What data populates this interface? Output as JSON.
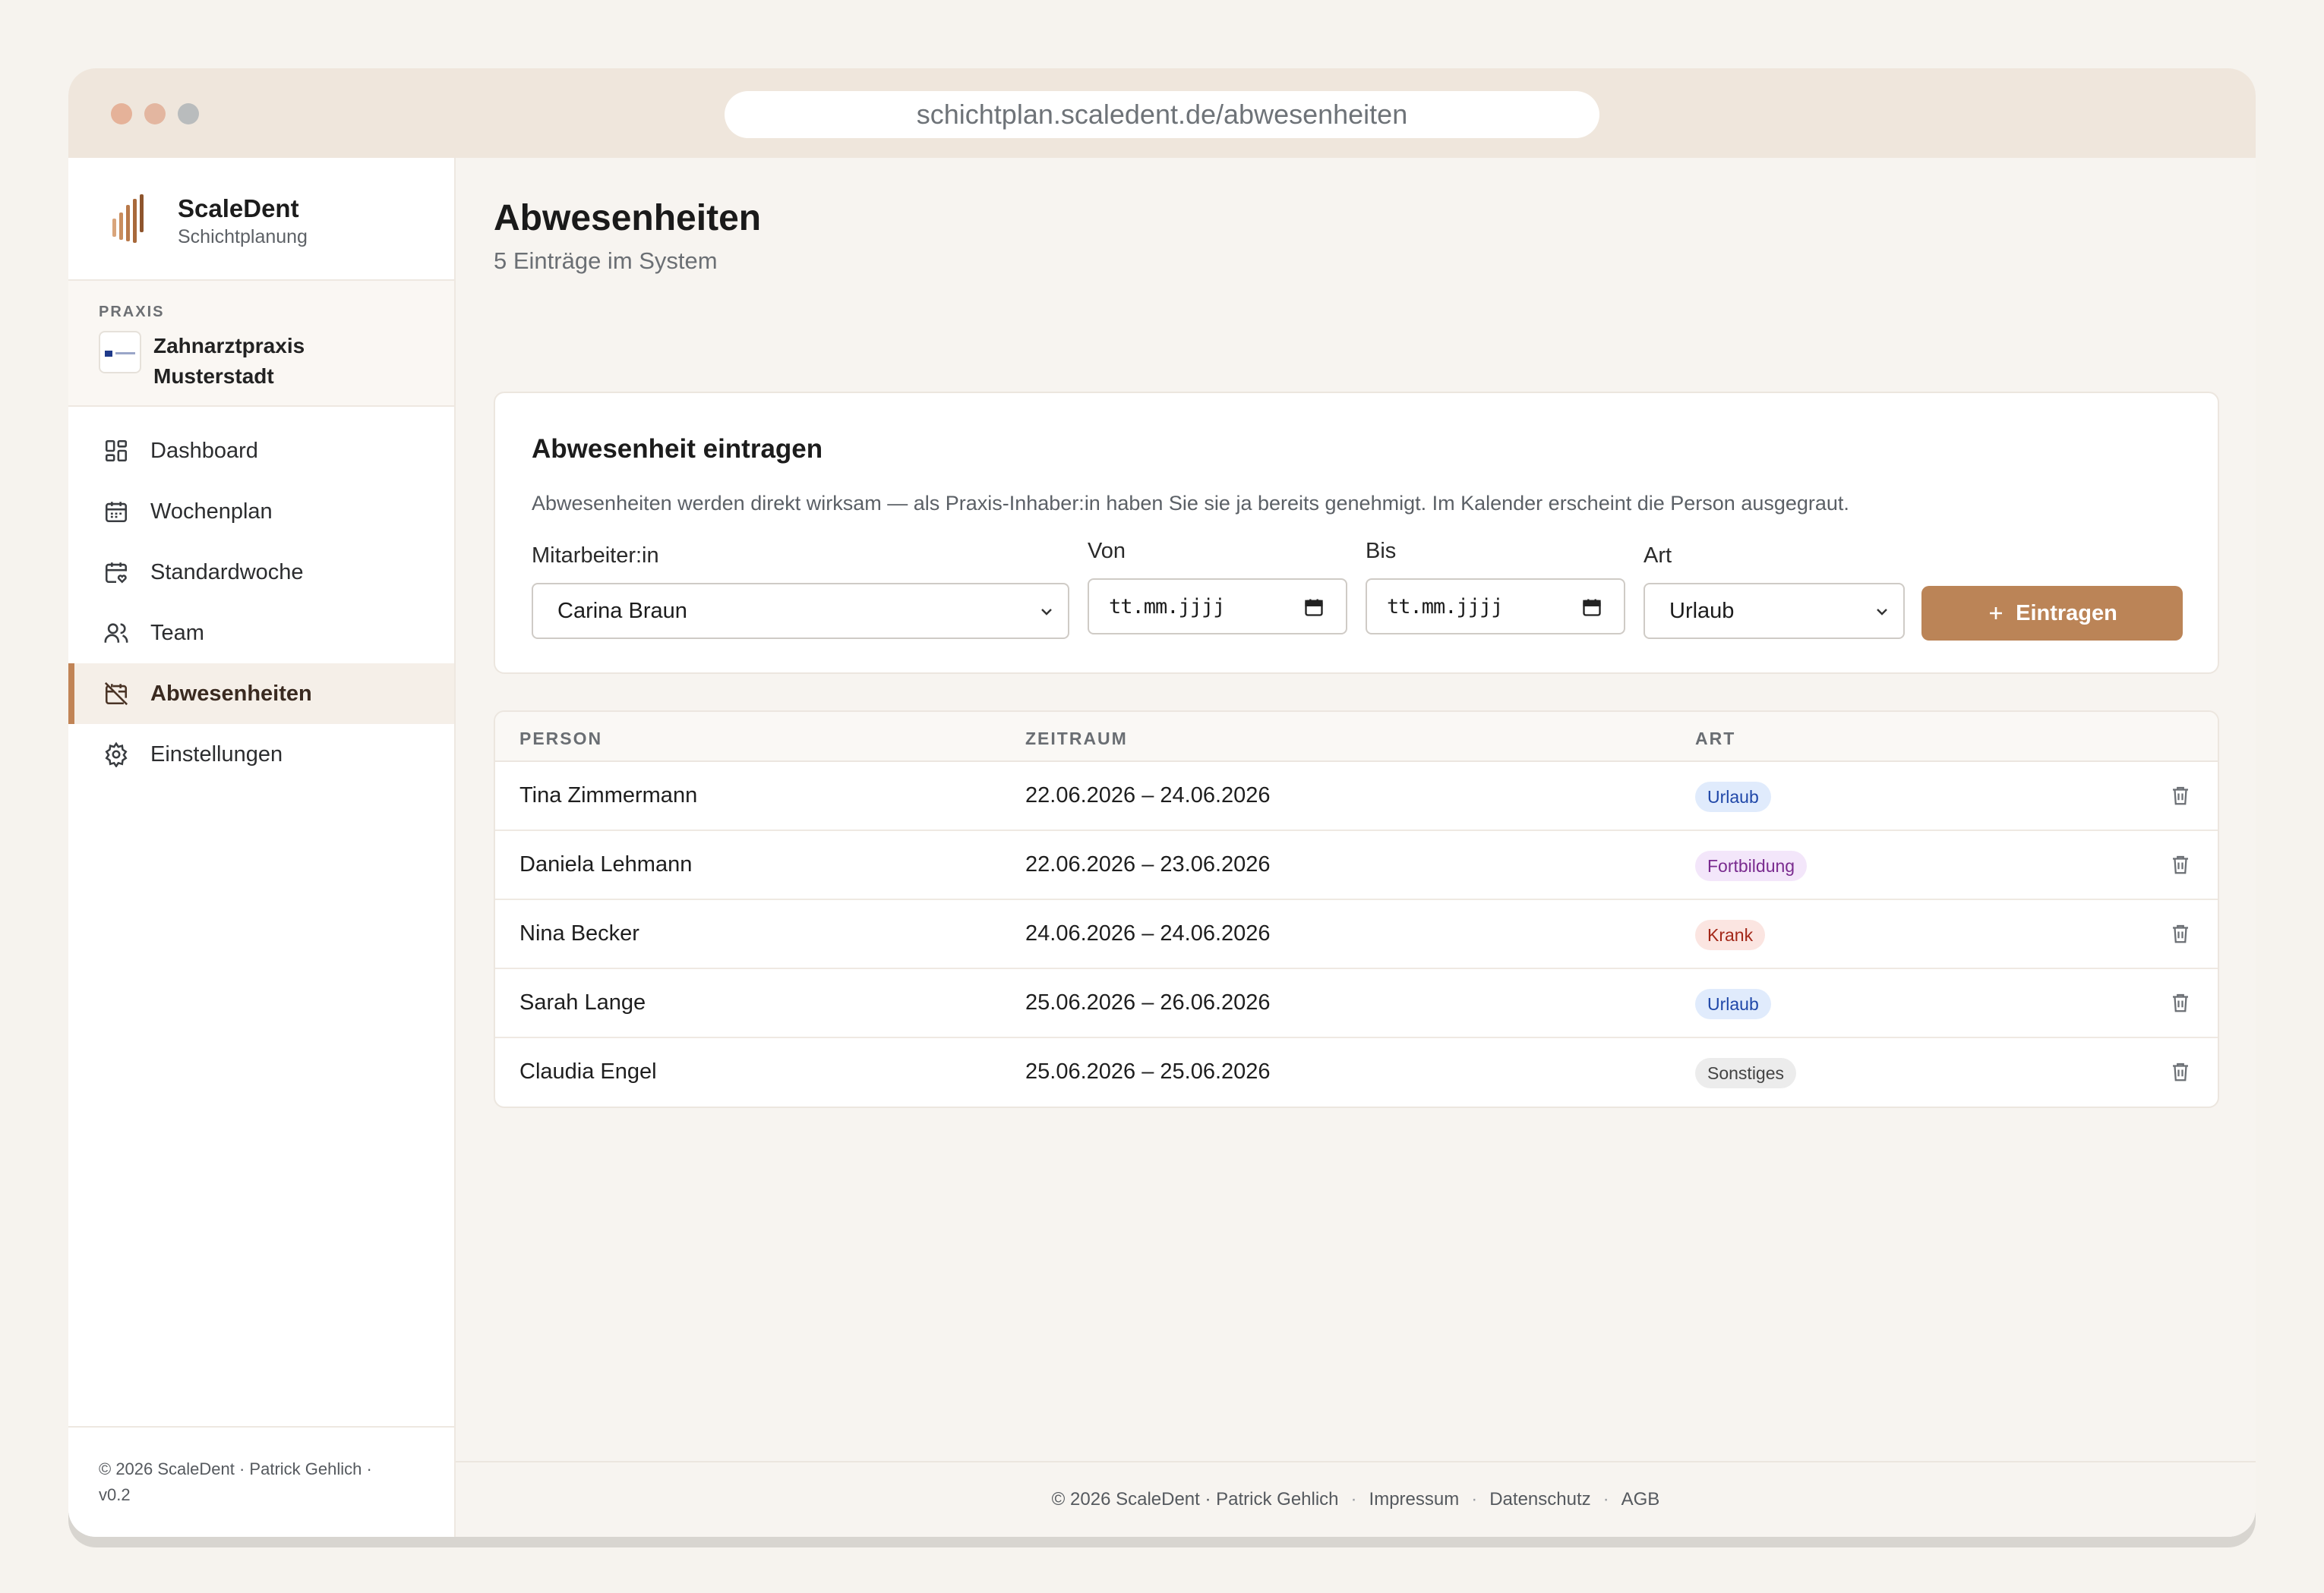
{
  "browser": {
    "url": "schichtplan.scaledent.de/abwesenheiten"
  },
  "brand": {
    "name": "ScaleDent",
    "subtitle": "Schichtplanung"
  },
  "praxis": {
    "label": "PRAXIS",
    "name": "Zahnarztpraxis Musterstadt"
  },
  "nav": [
    {
      "label": "Dashboard",
      "icon": "dashboard-icon",
      "active": false
    },
    {
      "label": "Wochenplan",
      "icon": "calendar-week-icon",
      "active": false
    },
    {
      "label": "Standardwoche",
      "icon": "calendar-heart-icon",
      "active": false
    },
    {
      "label": "Team",
      "icon": "users-icon",
      "active": false
    },
    {
      "label": "Abwesenheiten",
      "icon": "calendar-off-icon",
      "active": true
    },
    {
      "label": "Einstellungen",
      "icon": "gear-icon",
      "active": false
    }
  ],
  "sidebar_footer": {
    "line1": "© 2026 ScaleDent · Patrick Gehlich ·",
    "line2": "v0.2"
  },
  "page": {
    "title": "Abwesenheiten",
    "subtitle": "5 Einträge im System"
  },
  "form": {
    "title": "Abwesenheit eintragen",
    "description": "Abwesenheiten werden direkt wirksam — als Praxis-Inhaber:in haben Sie sie ja bereits genehmigt. Im Kalender erscheint die Person ausgegraut.",
    "employee_label": "Mitarbeiter:in",
    "employee_value": "Carina Braun",
    "from_label": "Von",
    "from_placeholder": "tt.mm.jjjj",
    "to_label": "Bis",
    "to_placeholder": "tt.mm.jjjj",
    "type_label": "Art",
    "type_value": "Urlaub",
    "submit_label": "Eintragen"
  },
  "table": {
    "headers": {
      "person": "PERSON",
      "period": "ZEITRAUM",
      "type": "ART"
    },
    "rows": [
      {
        "person": "Tina Zimmermann",
        "period": "22.06.2026 – 24.06.2026",
        "type": "Urlaub",
        "badge": "urlaub"
      },
      {
        "person": "Daniela Lehmann",
        "period": "22.06.2026 – 23.06.2026",
        "type": "Fortbildung",
        "badge": "fortbildung"
      },
      {
        "person": "Nina Becker",
        "period": "24.06.2026 – 24.06.2026",
        "type": "Krank",
        "badge": "krank"
      },
      {
        "person": "Sarah Lange",
        "period": "25.06.2026 – 26.06.2026",
        "type": "Urlaub",
        "badge": "urlaub"
      },
      {
        "person": "Claudia Engel",
        "period": "25.06.2026 – 25.06.2026",
        "type": "Sonstiges",
        "badge": "sonstiges"
      }
    ]
  },
  "footer": {
    "copyright": "© 2026 ScaleDent · Patrick Gehlich",
    "links": [
      "Impressum",
      "Datenschutz",
      "AGB"
    ]
  },
  "colors": {
    "accent": "#bb8457",
    "background": "#f6f3ee",
    "titlebar": "#efe6dc"
  }
}
